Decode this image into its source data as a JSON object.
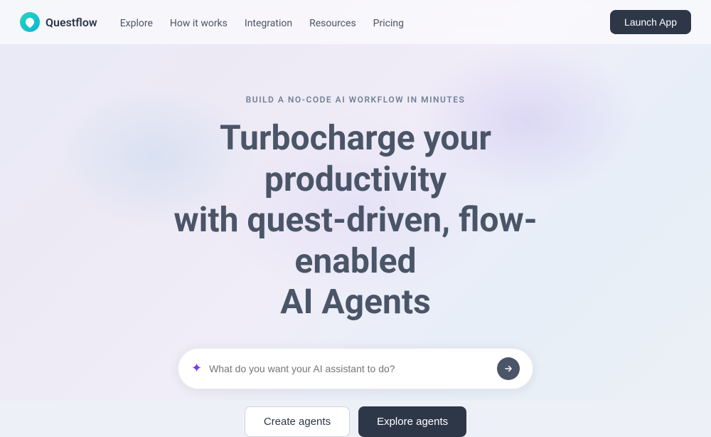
{
  "nav": {
    "logo_text": "Questflow",
    "links": [
      "Explore",
      "How it works",
      "Integration",
      "Resources",
      "Pricing"
    ],
    "launch_btn": "Launch App"
  },
  "hero": {
    "subtitle": "BUILD A NO-CODE AI WORKFLOW IN MINUTES",
    "title_line1": "Turbocharge your productivity",
    "title_line2": "with quest-driven, flow-enabled",
    "title_line3": "AI Agents",
    "search_placeholder": "What do you want your AI assistant to do?",
    "cta_create": "Create agents",
    "cta_explore": "Explore agents"
  }
}
